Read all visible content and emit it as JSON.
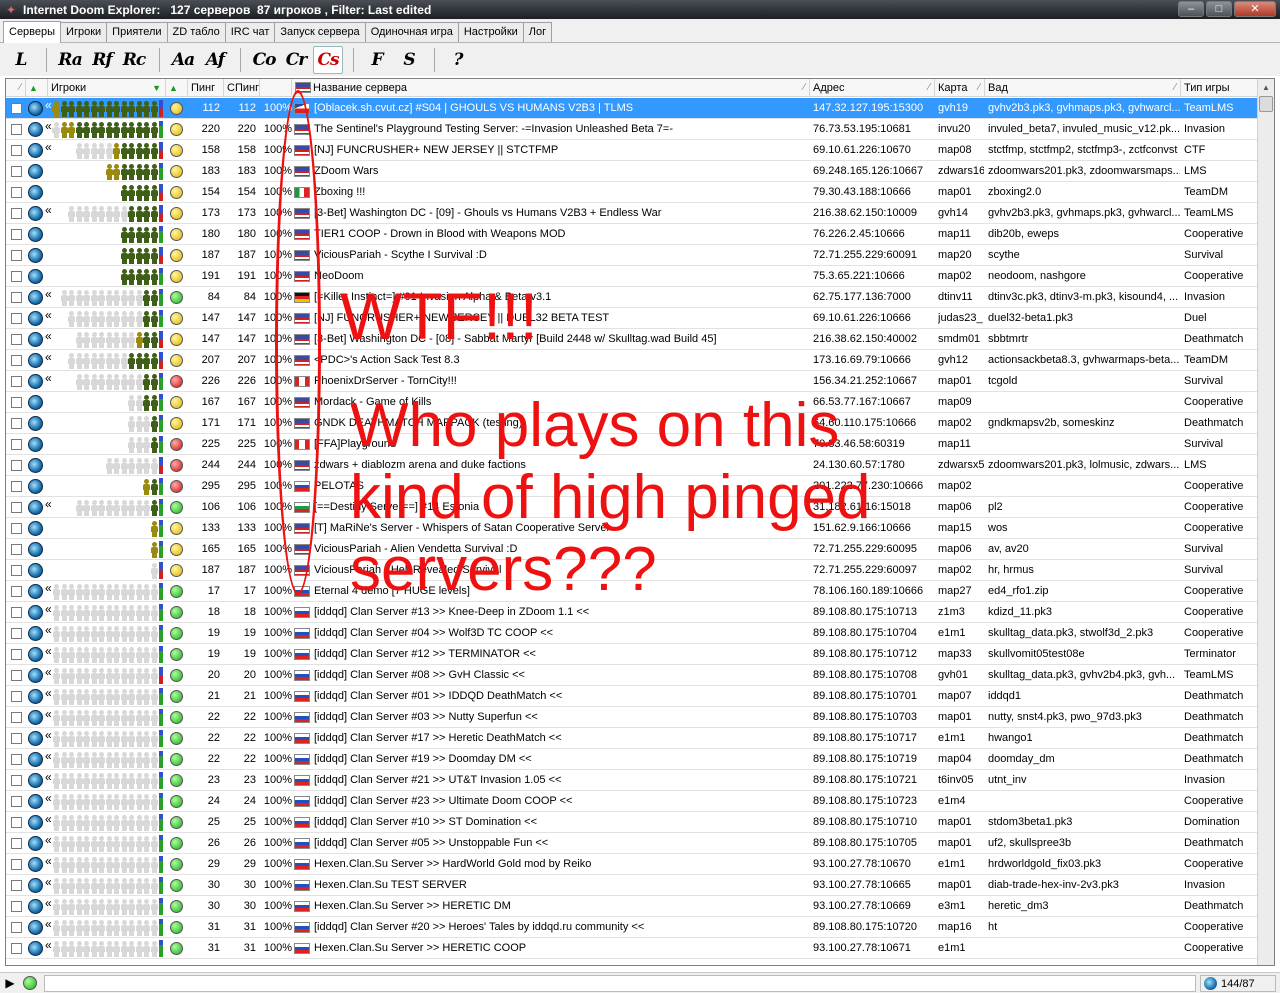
{
  "window": {
    "title": "Internet Doom Explorer:   127 серверов  87 игроков , Filter: Last edited",
    "minimize": "–",
    "maximize": "□",
    "close": "✕"
  },
  "tabs": [
    "Серверы",
    "Игроки",
    "Приятели",
    "ZD табло",
    "IRC чат",
    "Запуск сервера",
    "Одиночная игра",
    "Настройки",
    "Лог"
  ],
  "toolbar": [
    "L",
    "Ra",
    "Rf",
    "Rc",
    "Aa",
    "Af",
    "Co",
    "Cr",
    "Cs",
    "F",
    "S",
    "?"
  ],
  "columns": {
    "players": "Игроки",
    "ping": "Пинг",
    "sping": "СПинг",
    "name": "Название сервера",
    "address": "Адрес",
    "map": "Карта",
    "wad": "Вад",
    "gametype": "Тип игры"
  },
  "colors": {
    "selected_row": "#3399ff",
    "annotation": "#ee1111"
  },
  "rows": [
    {
      "ping": "112",
      "sping": "112",
      "pct": "100%",
      "flag": "cz",
      "name": "[Oblacek.sh.cvut.cz] #S04 | GHOULS VS HUMANS V2B3 | TLMS",
      "addr": "147.32.127.195:15300",
      "map": "gvh19",
      "wad": "gvhv2b3.pk3, gvhmaps.pk3, gvhwarcl...",
      "type": "TeamLMS",
      "dot": "yellow",
      "bar": "bu",
      "players": "yyyyyyddddddddddddd",
      "guillemet": true,
      "sel": true
    },
    {
      "ping": "220",
      "sping": "220",
      "pct": "100%",
      "flag": "us",
      "name": "The Sentinel's Playground Testing Server: -=Invasion Unleashed Beta 7=-",
      "addr": "76.73.53.195:10681",
      "map": "invu20",
      "wad": "invuled_beta7, invuled_music_v12.pk...",
      "type": "Invasion",
      "dot": "yellow",
      "bar": "g",
      "players": "ggggyyddddddddddd",
      "guillemet": true
    },
    {
      "ping": "158",
      "sping": "158",
      "pct": "100%",
      "flag": "us",
      "name": "[NJ] FUNCRUSHER+ NEW JERSEY || STCTFMP",
      "addr": "69.10.61.226:10670",
      "map": "map08",
      "wad": "stctfmp, stctfmp2, stctfmp3-, zctfconvst",
      "type": "CTF",
      "dot": "yellow",
      "bar": "bu",
      "players": "gggggyddddd",
      "guillemet": true
    },
    {
      "ping": "183",
      "sping": "183",
      "pct": "100%",
      "flag": "us",
      "name": "ZDoom Wars",
      "addr": "69.248.165.126:10667",
      "map": "zdwars16",
      "wad": "zdoomwars201.pk3, zdoomwarsmaps...",
      "type": "LMS",
      "dot": "yellow",
      "bar": "g",
      "players": "yyddddd"
    },
    {
      "ping": "154",
      "sping": "154",
      "pct": "100%",
      "flag": "it",
      "name": "Zboxing !!!",
      "addr": "79.30.43.188:10666",
      "map": "map01",
      "wad": "zboxing2.0",
      "type": "TeamDM",
      "dot": "yellow",
      "bar": "bu",
      "players": "ddddd"
    },
    {
      "ping": "173",
      "sping": "173",
      "pct": "100%",
      "flag": "us",
      "name": "[3-Bet] Washington DC - [09] - Ghouls vs Humans V2B3 + Endless War",
      "addr": "216.38.62.150:10009",
      "map": "gvh14",
      "wad": "gvhv2b3.pk3, gvhmaps.pk3, gvhwarcl...",
      "type": "TeamLMS",
      "dot": "yellow",
      "bar": "bu",
      "players": "ggggggggdddd",
      "guillemet": true
    },
    {
      "ping": "180",
      "sping": "180",
      "pct": "100%",
      "flag": "us",
      "name": "TIER1 COOP - Drown in Blood with Weapons MOD",
      "addr": "76.226.2.45:10666",
      "map": "map11",
      "wad": "dib20b, eweps",
      "type": "Cooperative",
      "dot": "yellow",
      "bar": "g",
      "players": "ddddd"
    },
    {
      "ping": "187",
      "sping": "187",
      "pct": "100%",
      "flag": "us",
      "name": "ViciousPariah - Scythe I Survival :D",
      "addr": "72.71.255.229:60091",
      "map": "map20",
      "wad": "scythe",
      "type": "Survival",
      "dot": "yellow",
      "bar": "bu",
      "players": "ddddd"
    },
    {
      "ping": "191",
      "sping": "191",
      "pct": "100%",
      "flag": "us",
      "name": "NeoDoom",
      "addr": "75.3.65.221:10666",
      "map": "map02",
      "wad": "neodoom, nashgore",
      "type": "Cooperative",
      "dot": "yellow",
      "bar": "g",
      "players": "ddddd"
    },
    {
      "ping": "84",
      "sping": "84",
      "pct": "100%",
      "flag": "de",
      "name": "[=Killer Instinct=] #01 Invasion Alpha & Beta v3.1",
      "addr": "62.75.177.136:7000",
      "map": "dtinv11",
      "wad": "dtinv3c.pk3, dtinv3-m.pk3, kisound4, ...",
      "type": "Invasion",
      "dot": "green",
      "bar": "g",
      "players": "gggggggggggdd",
      "guillemet": true
    },
    {
      "ping": "147",
      "sping": "147",
      "pct": "100%",
      "flag": "us",
      "name": "[NJ] FUNCRUSHER+ NEW JERSEY || DUEL32 BETA TEST",
      "addr": "69.10.61.226:10666",
      "map": "judas23_",
      "wad": "duel32-beta1.pk3",
      "type": "Duel",
      "dot": "yellow",
      "bar": "g",
      "players": "ggggggggggdd",
      "guillemet": true
    },
    {
      "ping": "147",
      "sping": "147",
      "pct": "100%",
      "flag": "us",
      "name": "[3-Bet] Washington DC - [08] - Sabbat Martyr [Build 2448 w/ Skulltag.wad Build 45]",
      "addr": "216.38.62.150:40002",
      "map": "smdm01",
      "wad": "sbbtmrtr",
      "type": "Deathmatch",
      "dot": "yellow",
      "bar": "bu",
      "players": "ggggggggydd",
      "guillemet": true
    },
    {
      "ping": "207",
      "sping": "207",
      "pct": "100%",
      "flag": "us",
      "name": "<PDC>'s Action Sack Test 8.3",
      "addr": "173.16.69.79:10666",
      "map": "gvh12",
      "wad": "actionsackbeta8.3, gvhwarmaps-beta...",
      "type": "TeamDM",
      "dot": "yellow",
      "bar": "bu",
      "players": "ggggggggdddd",
      "guillemet": true
    },
    {
      "ping": "226",
      "sping": "226",
      "pct": "100%",
      "flag": "ca",
      "name": "PhoenixDrServer - TornCity!!!",
      "addr": "156.34.21.252:10667",
      "map": "map01",
      "wad": "tcgold",
      "type": "Survival",
      "dot": "red",
      "bar": "g",
      "players": "gggggggggdd",
      "guillemet": true
    },
    {
      "ping": "167",
      "sping": "167",
      "pct": "100%",
      "flag": "us",
      "name": "Mordack - Game of Kills",
      "addr": "66.53.77.167:10667",
      "map": "map09",
      "wad": "",
      "type": "Cooperative",
      "dot": "yellow",
      "bar": "g",
      "players": "ggdd"
    },
    {
      "ping": "171",
      "sping": "171",
      "pct": "100%",
      "flag": "us",
      "name": "GNDK DEATHMATCH MAPPACK (testing)",
      "addr": "64.60.110.175:10666",
      "map": "map02",
      "wad": "gndkmapsv2b, someskinz",
      "type": "Deathmatch",
      "dot": "yellow",
      "bar": "g",
      "players": "gggd"
    },
    {
      "ping": "225",
      "sping": "225",
      "pct": "100%",
      "flag": "ca",
      "name": "[FFA]Playground",
      "addr": "70.83.46.58:60319",
      "map": "map11",
      "wad": "",
      "type": "Survival",
      "dot": "red",
      "bar": "g",
      "players": "gggd"
    },
    {
      "ping": "244",
      "sping": "244",
      "pct": "100%",
      "flag": "us",
      "name": "zdwars + diablozm arena and duke factions",
      "addr": "24.130.60.57:1780",
      "map": "zdwarsx5",
      "wad": "zdoomwars201.pk3, lolmusic, zdwars...",
      "type": "LMS",
      "dot": "red",
      "bar": "bu",
      "players": "ggggggg"
    },
    {
      "ping": "295",
      "sping": "295",
      "pct": "100%",
      "flag": "ru",
      "name": "PELOTAS",
      "addr": "201.222.77.230:10666",
      "map": "map02",
      "wad": "",
      "type": "Cooperative",
      "dot": "red",
      "bar": "g",
      "players": "yd"
    },
    {
      "ping": "106",
      "sping": "106",
      "pct": "100%",
      "flag": "bg",
      "name": "[==Destiny Server==] #14 Estonia",
      "addr": "31.182.61.16:15018",
      "map": "map06",
      "wad": "pl2",
      "type": "Cooperative",
      "dot": "green",
      "bar": "g",
      "players": "ggggggggggd",
      "guillemet": true
    },
    {
      "ping": "133",
      "sping": "133",
      "pct": "100%",
      "flag": "us",
      "name": "[T] MaRiNe's Server - Whispers of Satan Cooperative Server",
      "addr": "151.62.9.166:10666",
      "map": "map15",
      "wad": "wos",
      "type": "Cooperative",
      "dot": "yellow",
      "bar": "g",
      "players": "y"
    },
    {
      "ping": "165",
      "sping": "165",
      "pct": "100%",
      "flag": "us",
      "name": "ViciousPariah - Alien Vendetta Survival :D",
      "addr": "72.71.255.229:60095",
      "map": "map06",
      "wad": "av, av20",
      "type": "Survival",
      "dot": "yellow",
      "bar": "g",
      "players": "y"
    },
    {
      "ping": "187",
      "sping": "187",
      "pct": "100%",
      "flag": "us",
      "name": "ViciousPariah - Hell Revealed Survival",
      "addr": "72.71.255.229:60097",
      "map": "map02",
      "wad": "hr, hrmus",
      "type": "Survival",
      "dot": "yellow",
      "bar": "bu",
      "players": "g"
    },
    {
      "ping": "17",
      "sping": "17",
      "pct": "100%",
      "flag": "ru",
      "name": "Eternal 4 demo [7 HUGE levels]",
      "addr": "78.106.160.189:10666",
      "map": "map27",
      "wad": "ed4_rfo1.zip",
      "type": "Cooperative",
      "dot": "green",
      "bar": "g",
      "players": "gggggggggggggg",
      "guillemet": true
    },
    {
      "ping": "18",
      "sping": "18",
      "pct": "100%",
      "flag": "ru",
      "name": "[iddqd] Clan Server #13 >> Knee-Deep in ZDoom 1.1 <<",
      "addr": "89.108.80.175:10713",
      "map": "z1m3",
      "wad": "kdizd_11.pk3",
      "type": "Cooperative",
      "dot": "green",
      "bar": "g",
      "players": "gggggggggggggg",
      "guillemet": true
    },
    {
      "ping": "19",
      "sping": "19",
      "pct": "100%",
      "flag": "ru",
      "name": "[iddqd] Clan Server #04 >> Wolf3D TC COOP <<",
      "addr": "89.108.80.175:10704",
      "map": "e1m1",
      "wad": "skulltag_data.pk3, stwolf3d_2.pk3",
      "type": "Cooperative",
      "dot": "green",
      "bar": "g",
      "players": "gggggggggggggg",
      "guillemet": true
    },
    {
      "ping": "19",
      "sping": "19",
      "pct": "100%",
      "flag": "ru",
      "name": "[iddqd] Clan Server #12 >> TERMINATOR <<",
      "addr": "89.108.80.175:10712",
      "map": "map33",
      "wad": "skullvomit05test08e",
      "type": "Terminator",
      "dot": "green",
      "bar": "g",
      "players": "gggggggggggggg",
      "guillemet": true
    },
    {
      "ping": "20",
      "sping": "20",
      "pct": "100%",
      "flag": "ru",
      "name": "[iddqd] Clan Server #08 >> GvH Classic <<",
      "addr": "89.108.80.175:10708",
      "map": "gvh01",
      "wad": "skulltag_data.pk3, gvhv2b4.pk3, gvh...",
      "type": "TeamLMS",
      "dot": "green",
      "bar": "bu",
      "players": "gggggggggggggg",
      "guillemet": true
    },
    {
      "ping": "21",
      "sping": "21",
      "pct": "100%",
      "flag": "ru",
      "name": "[iddqd] Clan Server #01 >> IDDQD DeathMatch <<",
      "addr": "89.108.80.175:10701",
      "map": "map07",
      "wad": "iddqd1",
      "type": "Deathmatch",
      "dot": "green",
      "bar": "g",
      "players": "gggggggggggggg",
      "guillemet": true
    },
    {
      "ping": "22",
      "sping": "22",
      "pct": "100%",
      "flag": "ru",
      "name": "[iddqd] Clan Server #03 >> Nutty Superfun <<",
      "addr": "89.108.80.175:10703",
      "map": "map01",
      "wad": "nutty, snst4.pk3, pwo_97d3.pk3",
      "type": "Deathmatch",
      "dot": "green",
      "bar": "g",
      "players": "gggggggggggggg",
      "guillemet": true
    },
    {
      "ping": "22",
      "sping": "22",
      "pct": "100%",
      "flag": "ru",
      "name": "[iddqd] Clan Server #17 >> Heretic DeathMatch <<",
      "addr": "89.108.80.175:10717",
      "map": "e1m1",
      "wad": "hwango1",
      "type": "Deathmatch",
      "dot": "green",
      "bar": "g",
      "players": "gggggggggggggg",
      "guillemet": true
    },
    {
      "ping": "22",
      "sping": "22",
      "pct": "100%",
      "flag": "ru",
      "name": "[iddqd] Clan Server #19 >> Doomday DM <<",
      "addr": "89.108.80.175:10719",
      "map": "map04",
      "wad": "doomday_dm",
      "type": "Deathmatch",
      "dot": "green",
      "bar": "g",
      "players": "gggggggggggggg",
      "guillemet": true
    },
    {
      "ping": "23",
      "sping": "23",
      "pct": "100%",
      "flag": "ru",
      "name": "[iddqd] Clan Server #21 >> UT&T Invasion 1.05 <<",
      "addr": "89.108.80.175:10721",
      "map": "t6inv05",
      "wad": "utnt_inv",
      "type": "Invasion",
      "dot": "green",
      "bar": "g",
      "players": "gggggggggggggg",
      "guillemet": true
    },
    {
      "ping": "24",
      "sping": "24",
      "pct": "100%",
      "flag": "ru",
      "name": "[iddqd] Clan Server #23 >> Ultimate Doom COOP <<",
      "addr": "89.108.80.175:10723",
      "map": "e1m4",
      "wad": "",
      "type": "Cooperative",
      "dot": "green",
      "bar": "g",
      "players": "gggggggggggggg",
      "guillemet": true
    },
    {
      "ping": "25",
      "sping": "25",
      "pct": "100%",
      "flag": "ru",
      "name": "[iddqd] Clan Server #10 >> ST Domination <<",
      "addr": "89.108.80.175:10710",
      "map": "map01",
      "wad": "stdom3beta1.pk3",
      "type": "Domination",
      "dot": "green",
      "bar": "g",
      "players": "gggggggggggggg",
      "guillemet": true
    },
    {
      "ping": "26",
      "sping": "26",
      "pct": "100%",
      "flag": "ru",
      "name": "[iddqd] Clan Server #05 >> Unstoppable Fun <<",
      "addr": "89.108.80.175:10705",
      "map": "map01",
      "wad": "uf2, skullspree3b",
      "type": "Deathmatch",
      "dot": "green",
      "bar": "g",
      "players": "gggggggggggggg",
      "guillemet": true
    },
    {
      "ping": "29",
      "sping": "29",
      "pct": "100%",
      "flag": "ru",
      "name": "Hexen.Clan.Su Server >> HardWorld Gold mod by Reiko",
      "addr": "93.100.27.78:10670",
      "map": "e1m1",
      "wad": "hrdworldgold_fix03.pk3",
      "type": "Cooperative",
      "dot": "green",
      "bar": "g",
      "players": "gggggggggggggg",
      "guillemet": true
    },
    {
      "ping": "30",
      "sping": "30",
      "pct": "100%",
      "flag": "ru",
      "name": "Hexen.Clan.Su TEST SERVER",
      "addr": "93.100.27.78:10665",
      "map": "map01",
      "wad": "diab-trade-hex-inv-2v3.pk3",
      "type": "Invasion",
      "dot": "green",
      "bar": "g",
      "players": "gggggggggggggg",
      "guillemet": true
    },
    {
      "ping": "30",
      "sping": "30",
      "pct": "100%",
      "flag": "ru",
      "name": "Hexen.Clan.Su Server >> HERETIC DM",
      "addr": "93.100.27.78:10669",
      "map": "e3m1",
      "wad": "heretic_dm3",
      "type": "Deathmatch",
      "dot": "green",
      "bar": "g",
      "players": "gggggggggggggg",
      "guillemet": true
    },
    {
      "ping": "31",
      "sping": "31",
      "pct": "100%",
      "flag": "ru",
      "name": "[iddqd] Clan Server #20 >> Heroes' Tales by iddqd.ru community <<",
      "addr": "89.108.80.175:10720",
      "map": "map16",
      "wad": "ht",
      "type": "Cooperative",
      "dot": "green",
      "bar": "g",
      "players": "gggggggggggggg",
      "guillemet": true
    },
    {
      "ping": "31",
      "sping": "31",
      "pct": "100%",
      "flag": "ru",
      "name": "Hexen.Clan.Su Server >> HERETIC COOP",
      "addr": "93.100.27.78:10671",
      "map": "e1m1",
      "wad": "",
      "type": "Cooperative",
      "dot": "green",
      "bar": "g",
      "players": "gggggggggggggg",
      "guillemet": true
    }
  ],
  "status": {
    "count": "144/87"
  },
  "annotation": {
    "headline": "WTF!!!",
    "body": "Who plays on this\nkind of high pinged\nservers???"
  }
}
